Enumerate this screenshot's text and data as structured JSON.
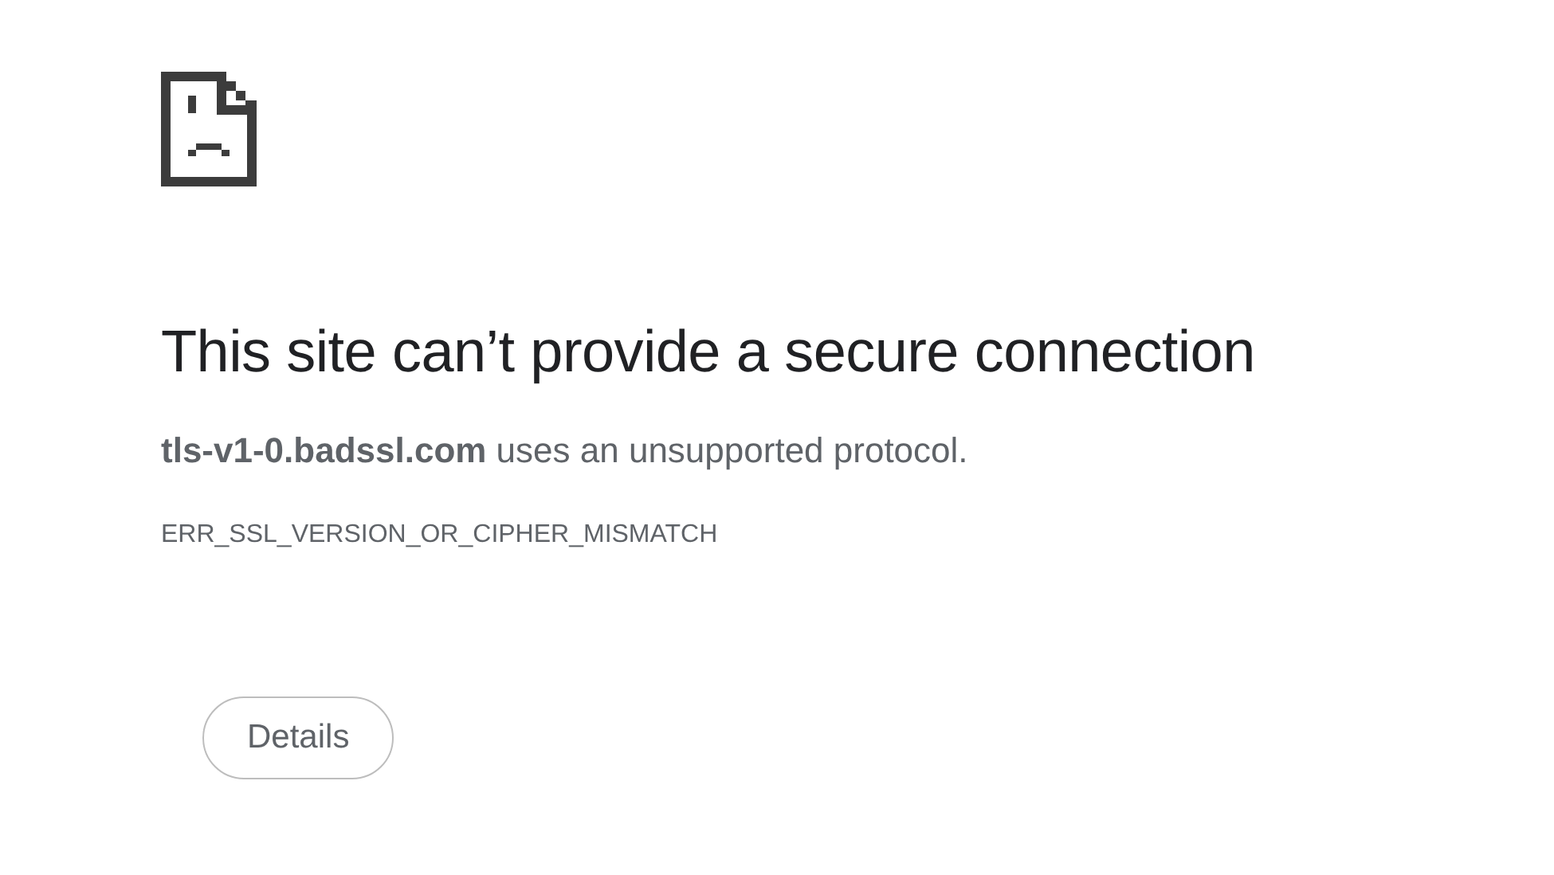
{
  "heading": "This site can’t provide a secure connection",
  "message": "**tls-v1-0.badssl.com** uses an unsupported protocol.",
  "error_code": "ERR_SSL_VERSION_OR_CIPHER_MISMATCH",
  "buttons": [
    {
      "label": "Details"
    }
  ]
}
